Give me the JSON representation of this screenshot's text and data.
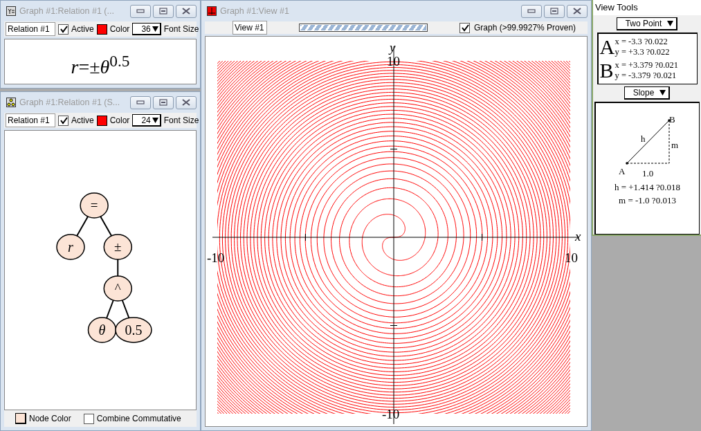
{
  "relation_window": {
    "title": "Graph #1:Relation #1 (...",
    "name": "Relation #1",
    "active": true,
    "active_label": "Active",
    "color": "#ff0000",
    "color_label": "Color",
    "font_size": "36",
    "font_size_label": "Font Size",
    "expression": "*r*=±*θ*$^{0.5}$"
  },
  "tree_window": {
    "title": "Graph #1:Relation #1 (S...",
    "name": "Relation #1",
    "active": true,
    "active_label": "Active",
    "color": "#ff0000",
    "color_label": "Color",
    "font_size": "24",
    "font_size_label": "Font Size",
    "tree": {
      "label": "=",
      "kind": "operator",
      "children": [
        {
          "label": "r",
          "kind": "variable"
        },
        {
          "label": "±",
          "kind": "operator",
          "children": [
            {
              "label": "^",
              "kind": "operator",
              "children": [
                {
                  "label": "θ",
                  "kind": "variable"
                },
                {
                  "label": "0.5",
                  "kind": "number"
                }
              ]
            }
          ]
        }
      ]
    },
    "node_color_label": "Node Color",
    "combine_checked": false,
    "combine_label": "Combine Commutative"
  },
  "view_window": {
    "title": "Graph #1:View #1",
    "view_name": "View #1",
    "progress": {
      "level": 1
    },
    "graph_checked": true,
    "graph_label": "Graph (>99.9927% Proven)",
    "x_label": "x",
    "y_label": "y",
    "x_min": "-10",
    "x_max": "10",
    "y_min": "-10",
    "y_max": "10"
  },
  "view_tools": {
    "title": "View Tools",
    "point_tool": "Two Point",
    "points": [
      {
        "name": "A",
        "x": "x = -3.3 ?0.022",
        "y": "y = +3.3 ?0.022"
      },
      {
        "name": "B",
        "x": "x = +3.379 ?0.021",
        "y": "y = -3.379 ?0.021"
      }
    ],
    "measure_tool": "Slope",
    "diagram": {
      "b": "B",
      "h": "h",
      "m": "m",
      "a": "A",
      "run": "1.0"
    },
    "h_result": "h = +1.414 ?0.018",
    "m_result": "m = -1.0 ?0.013"
  }
}
